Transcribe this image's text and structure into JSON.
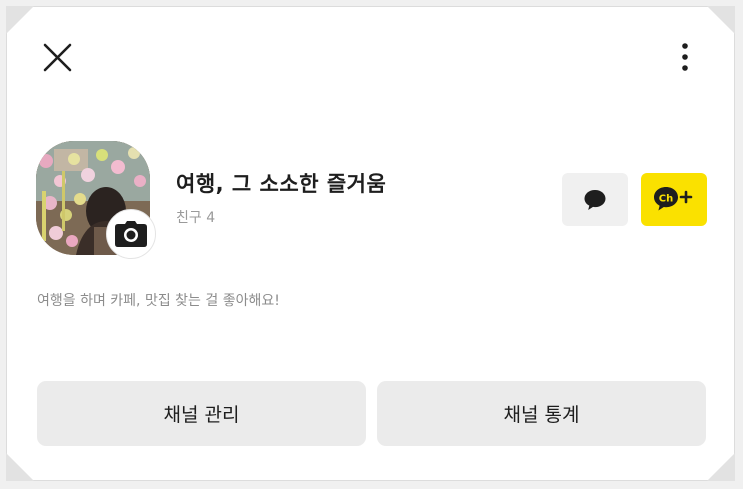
{
  "header": {
    "close_icon": "close-icon",
    "more_icon": "more-vertical-icon"
  },
  "profile": {
    "name": "여행, 그 소소한 즐거움",
    "friends_label": "친구 4",
    "avatar_icon": "profile-photo",
    "camera_icon": "camera-icon",
    "description": "여행을 하며 카페, 맛집 찾는 걸 좋아해요!"
  },
  "quick_actions": {
    "chat_icon": "chat-bubble-icon",
    "channel_add_icon": "channel-add-icon",
    "channel_add_text": "Ch+"
  },
  "buttons": {
    "manage_label": "채널 관리",
    "stats_label": "채널 통계"
  },
  "colors": {
    "accent_yellow": "#fae100",
    "button_gray": "#ebebeb",
    "text_dark": "#1e1e1e",
    "text_muted": "#9a9a9a"
  }
}
